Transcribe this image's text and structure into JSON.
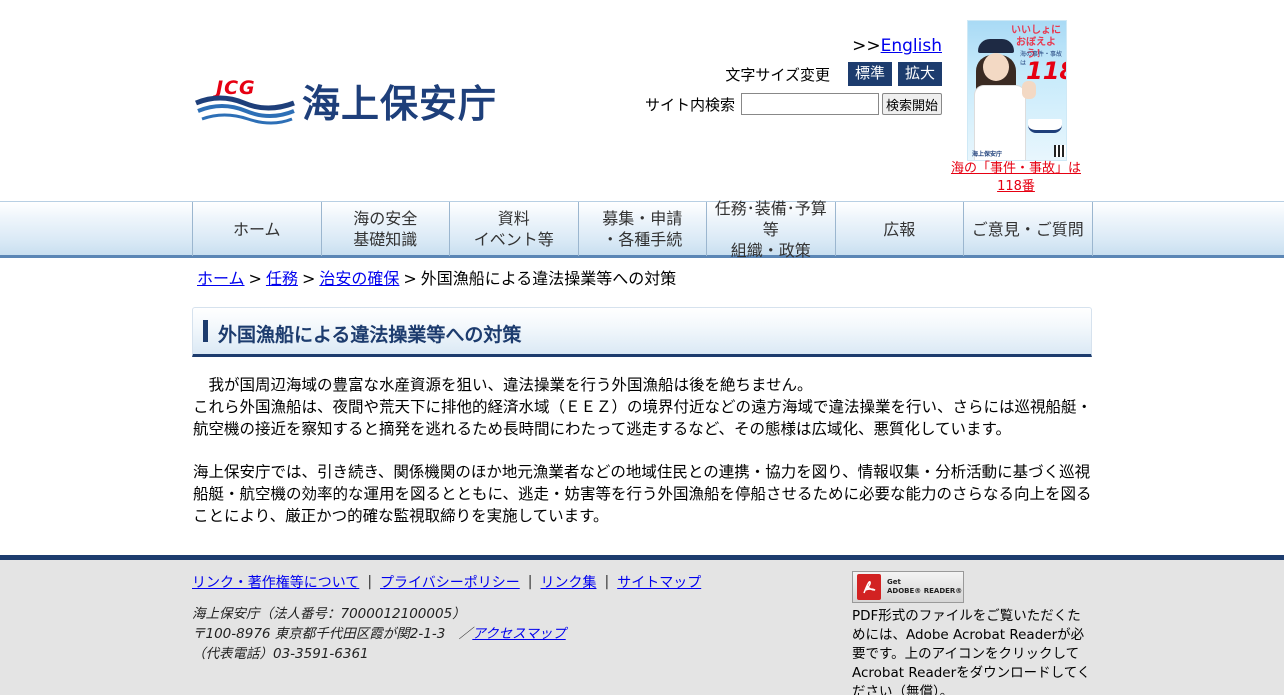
{
  "header": {
    "logo_mark_text": "JCG",
    "logo_title": "海上保安庁",
    "english_prefix": ">>",
    "english_link": "English",
    "fontsize_label": "文字サイズ変更",
    "fontsize_normal": "標準",
    "fontsize_large": "拡大",
    "search_label": "サイト内検索",
    "search_value": "",
    "search_button": "検索開始",
    "poster_caption": "海の「事件・事故」は118番",
    "poster_headline": "いいしょにおぼえよう！",
    "poster_number": "118",
    "poster_small": "海の事件・事故は",
    "poster_logo": "海上保安庁"
  },
  "nav": [
    {
      "label": "ホーム"
    },
    {
      "label": "海の安全\n基礎知識"
    },
    {
      "label": "資料\nイベント等"
    },
    {
      "label": "募集・申請\n・各種手続"
    },
    {
      "label": "任務･装備･予算等\n組織・政策"
    },
    {
      "label": "広報"
    },
    {
      "label": "ご意見・ご質問"
    }
  ],
  "breadcrumb": {
    "home": "ホーム",
    "mission": "任務",
    "security": "治安の確保",
    "current": "外国漁船による違法操業等への対策",
    "separator": ">"
  },
  "page": {
    "title": "外国漁船による違法操業等への対策",
    "paragraph1_line1": "　我が国周辺海域の豊富な水産資源を狙い、違法操業を行う外国漁船は後を絶ちません。",
    "paragraph1_line2": "これら外国漁船は、夜間や荒天下に排他的経済水域（ＥＥＺ）の境界付近などの遠方海域で違法操業を行い、さらには巡視船艇・航空機の接近を察知すると摘発を逃れるため長時間にわたって逃走するなど、その態様は広域化、悪質化しています。",
    "paragraph2": "海上保安庁では、引き続き、関係機関のほか地元漁業者などの地域住民との連携・協力を図り、情報収集・分析活動に基づく巡視船艇・航空機の効率的な運用を図るとともに、逃走・妨害等を行う外国漁船を停船させるために必要な能力のさらなる向上を図ることにより、厳正かつ的確な監視取締りを実施しています。"
  },
  "footer": {
    "links": [
      "リンク・著作権等について",
      "プライバシーポリシー",
      "リンク集",
      "サイトマップ"
    ],
    "separator": "|",
    "org_name": "海上保安庁（法人番号：7000012100005）",
    "address": "〒100-8976 東京都千代田区霞が関2-1-3　／",
    "access_map": "アクセスマップ",
    "phone": "（代表電話）03-3591-6361",
    "acrobat_badge_line1": "Get",
    "acrobat_badge_line2": "ADOBE® READER®",
    "acrobat_text": "PDF形式のファイルをご覧いただくためには、Adobe Acrobat Readerが必要です。上のアイコンをクリックしてAcrobat Readerをダウンロードしてください（無償）。"
  },
  "colors": {
    "brand_navy": "#1d3c6e",
    "link_blue": "#0000ee",
    "alert_red": "#e60012",
    "footer_bg": "#e4e4e4"
  }
}
